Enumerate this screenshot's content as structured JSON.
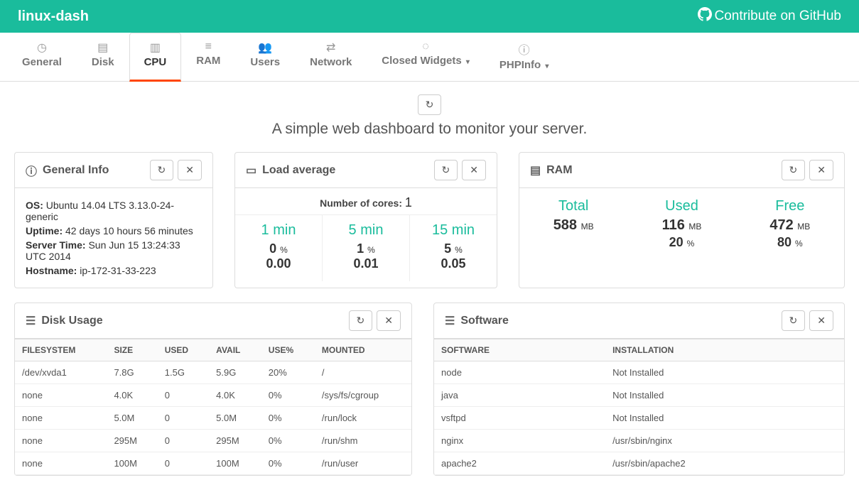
{
  "header": {
    "brand": "linux-dash",
    "github": "Contribute on GitHub"
  },
  "tabs": [
    {
      "label": "General",
      "icon": "◷"
    },
    {
      "label": "Disk",
      "icon": "▤"
    },
    {
      "label": "CPU",
      "icon": "▥"
    },
    {
      "label": "RAM",
      "icon": "≡"
    },
    {
      "label": "Users",
      "icon": "👥"
    },
    {
      "label": "Network",
      "icon": "⇄"
    },
    {
      "label": "Closed Widgets",
      "icon": "◌",
      "caret": true
    },
    {
      "label": "PHPInfo",
      "icon": "ⓘ",
      "caret": true
    }
  ],
  "active_tab": 2,
  "tagline": "A simple web dashboard to monitor your server.",
  "general": {
    "title": "General Info",
    "os_label": "OS:",
    "os": "Ubuntu 14.04 LTS 3.13.0-24-generic",
    "uptime_label": "Uptime:",
    "uptime": "42 days 10 hours 56 minutes",
    "servertime_label": "Server Time:",
    "servertime": "Sun Jun 15 13:24:33 UTC 2014",
    "hostname_label": "Hostname:",
    "hostname": "ip-172-31-33-223"
  },
  "load": {
    "title": "Load average",
    "cores_label": "Number of cores:",
    "cores": "1",
    "cols": [
      {
        "label": "1 min",
        "pct": "0",
        "val": "0.00"
      },
      {
        "label": "5 min",
        "pct": "1",
        "val": "0.01"
      },
      {
        "label": "15 min",
        "pct": "5",
        "val": "0.05"
      }
    ]
  },
  "ram": {
    "title": "RAM",
    "total_label": "Total",
    "total": "588",
    "used_label": "Used",
    "used": "116",
    "used_pct": "20",
    "free_label": "Free",
    "free": "472",
    "free_pct": "80",
    "unit": "MB"
  },
  "disk": {
    "title": "Disk Usage",
    "headers": [
      "FILESYSTEM",
      "SIZE",
      "USED",
      "AVAIL",
      "USE%",
      "MOUNTED"
    ],
    "rows": [
      [
        "/dev/xvda1",
        "7.8G",
        "1.5G",
        "5.9G",
        "20%",
        "/"
      ],
      [
        "none",
        "4.0K",
        "0",
        "4.0K",
        "0%",
        "/sys/fs/cgroup"
      ],
      [
        "none",
        "5.0M",
        "0",
        "5.0M",
        "0%",
        "/run/lock"
      ],
      [
        "none",
        "295M",
        "0",
        "295M",
        "0%",
        "/run/shm"
      ],
      [
        "none",
        "100M",
        "0",
        "100M",
        "0%",
        "/run/user"
      ]
    ]
  },
  "software": {
    "title": "Software",
    "headers": [
      "SOFTWARE",
      "INSTALLATION"
    ],
    "rows": [
      [
        "node",
        "Not Installed"
      ],
      [
        "java",
        "Not Installed"
      ],
      [
        "vsftpd",
        "Not Installed"
      ],
      [
        "nginx",
        "/usr/sbin/nginx"
      ],
      [
        "apache2",
        "/usr/sbin/apache2"
      ]
    ]
  }
}
